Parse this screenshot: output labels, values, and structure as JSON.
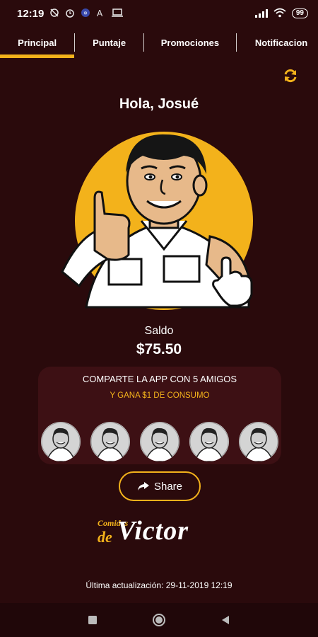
{
  "status_bar": {
    "time": "12:19",
    "icons": [
      "sync-off-icon",
      "alarm-icon",
      "vpn-icon",
      "font-icon",
      "cast-icon"
    ],
    "battery": "99"
  },
  "tabs": [
    {
      "label": "Principal",
      "active": true
    },
    {
      "label": "Puntaje",
      "active": false
    },
    {
      "label": "Promociones",
      "active": false
    },
    {
      "label": "Notificacion",
      "active": false
    }
  ],
  "greeting": "Hola, Josué",
  "balance": {
    "label": "Saldo",
    "value": "$75.50"
  },
  "share_card": {
    "title": "COMPARTE LA APP CON 5 AMIGOS",
    "subtitle": "Y GANA $1 DE CONSUMO",
    "friend_slots": 5
  },
  "share_button": {
    "label": "Share"
  },
  "logo": {
    "small": "Comidas",
    "de": "de",
    "big": "Victor"
  },
  "last_update": "Última actualización: 29-11-2019 12:19",
  "colors": {
    "background": "#2a0a0c",
    "card": "#3d1014",
    "accent": "#f3b21b",
    "navbar": "#200709"
  }
}
